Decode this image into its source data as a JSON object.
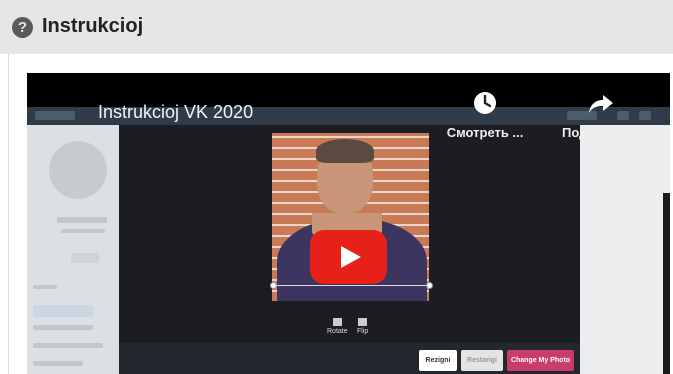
{
  "panel": {
    "title": "Instrukcioj",
    "help_icon": "question-circle-icon"
  },
  "video": {
    "title": "Instrukcioj VK 2020",
    "actions": [
      {
        "label": "Смотреть ...",
        "icon": "clock-icon"
      },
      {
        "label": "Поделиться",
        "icon": "share-arrow-icon"
      }
    ],
    "play_icon": "youtube-play-icon",
    "colors": {
      "play": "#e62117",
      "accent": "#c83d6a"
    }
  },
  "editor": {
    "tools": [
      "Rotate",
      "Flip"
    ],
    "buttons": {
      "reset": "Rezigni",
      "cancel": "Restarigi",
      "change": "Change My Photo"
    }
  }
}
